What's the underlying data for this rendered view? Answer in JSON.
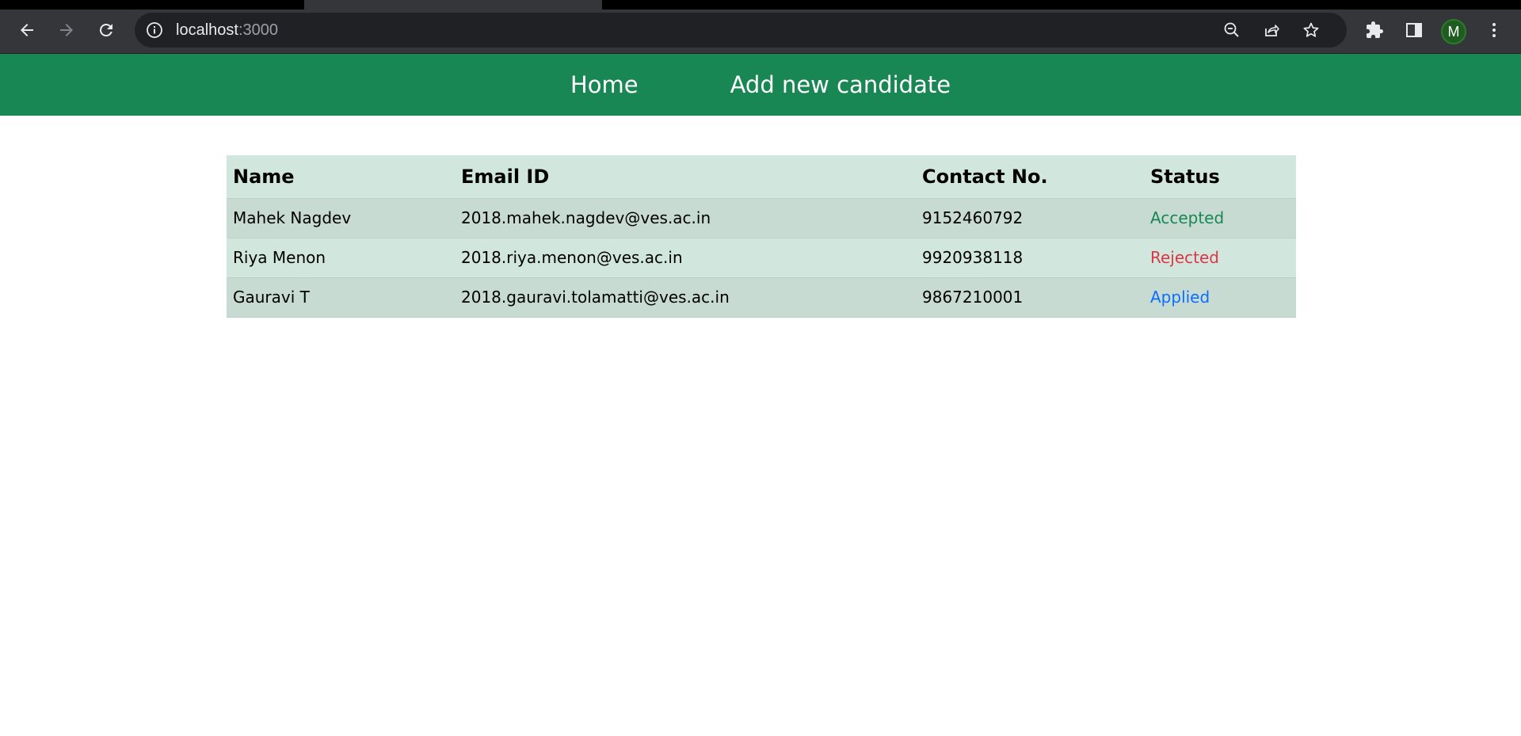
{
  "browser": {
    "url_host": "localhost",
    "url_port": ":3000",
    "profile_initial": "M",
    "icons": {
      "back": "arrow-left-icon",
      "forward": "arrow-right-icon",
      "reload": "reload-icon",
      "site_info": "info-icon",
      "zoom": "zoom-out-icon",
      "share": "share-icon",
      "bookmark": "star-icon",
      "extensions": "puzzle-icon",
      "side_panel": "side-panel-icon",
      "menu": "kebab-menu-icon"
    }
  },
  "navbar": {
    "color": "#198754",
    "links": [
      {
        "label": "Home"
      },
      {
        "label": "Add new candidate"
      }
    ]
  },
  "table": {
    "headers": [
      "Name",
      "Email ID",
      "Contact No.",
      "Status"
    ],
    "rows": [
      {
        "name": "Mahek Nagdev",
        "email": "2018.mahek.nagdev@ves.ac.in",
        "contact": "9152460792",
        "status": "Accepted",
        "status_color": "#198754"
      },
      {
        "name": "Riya Menon",
        "email": "2018.riya.menon@ves.ac.in",
        "contact": "9920938118",
        "status": "Rejected",
        "status_color": "#dc3545"
      },
      {
        "name": "Gauravi T",
        "email": "2018.gauravi.tolamatti@ves.ac.in",
        "contact": "9867210001",
        "status": "Applied",
        "status_color": "#0d6efd"
      }
    ]
  }
}
